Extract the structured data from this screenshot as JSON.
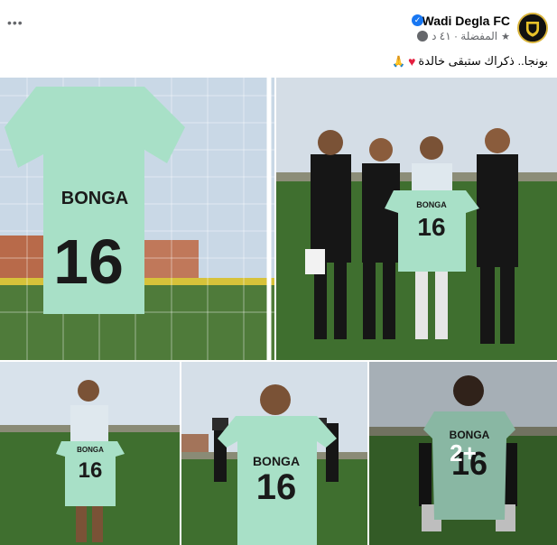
{
  "header": {
    "page_name": "Wadi Degla FC",
    "meta_text": "المفضلة · ٤١ د",
    "more_label": "•••"
  },
  "post": {
    "caption": "بونجا.. ذكراك ستبقى خالدة"
  },
  "photos": {
    "shirt_name": "BONGA",
    "shirt_number": "16",
    "more_count": "2+"
  },
  "colors": {
    "verified": "#1877f2",
    "shirt": "#a8e0c7",
    "kit_black": "#161616",
    "kit_yellow": "#e8c22a",
    "grass": "#3f6f2f",
    "sky": "#cfdbe6"
  }
}
